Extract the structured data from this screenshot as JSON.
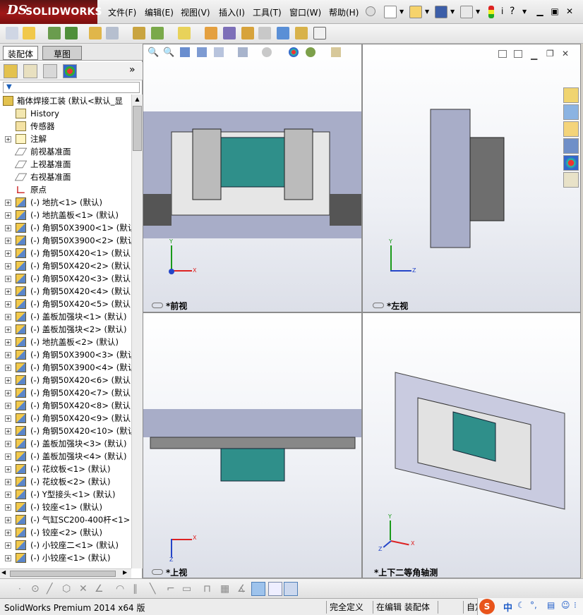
{
  "app": {
    "logo_ds": "DS",
    "logo_name": "SOLIDWORKS"
  },
  "menu": [
    "文件(F)",
    "编辑(E)",
    "视图(V)",
    "插入(I)",
    "工具(T)",
    "窗口(W)",
    "帮助(H)"
  ],
  "panel": {
    "tabs": [
      "装配体",
      "草图"
    ],
    "expand_glyph": "»",
    "filter_glyph": "▼"
  },
  "tree": {
    "root": "箱体焊接工装  (默认<默认_显",
    "items": [
      {
        "label": "History",
        "icon": "history-icon",
        "expand": false
      },
      {
        "label": "传感器",
        "icon": "sensor-icon",
        "expand": false
      },
      {
        "label": "注解",
        "icon": "annotation-icon",
        "expand": true
      },
      {
        "label": "前视基准面",
        "icon": "plane-icon",
        "expand": false
      },
      {
        "label": "上视基准面",
        "icon": "plane-icon",
        "expand": false
      },
      {
        "label": "右视基准面",
        "icon": "plane-icon",
        "expand": false
      },
      {
        "label": "原点",
        "icon": "origin-icon",
        "expand": false
      },
      {
        "label": "(-) 地抗<1> (默认)",
        "icon": "part-icon",
        "expand": true
      },
      {
        "label": "(-) 地抗盖板<1> (默认)",
        "icon": "part-icon",
        "expand": true
      },
      {
        "label": "(-) 角钢50X3900<1> (默认",
        "icon": "part-icon",
        "expand": true
      },
      {
        "label": "(-) 角钢50X3900<2> (默认",
        "icon": "part-icon",
        "expand": true
      },
      {
        "label": "(-) 角钢50X420<1> (默认)",
        "icon": "part-icon",
        "expand": true
      },
      {
        "label": "(-) 角钢50X420<2> (默认)",
        "icon": "part-icon",
        "expand": true
      },
      {
        "label": "(-) 角钢50X420<3> (默认)",
        "icon": "part-icon",
        "expand": true
      },
      {
        "label": "(-) 角钢50X420<4> (默认)",
        "icon": "part-icon",
        "expand": true
      },
      {
        "label": "(-) 角钢50X420<5> (默认)",
        "icon": "part-icon",
        "expand": true
      },
      {
        "label": "(-) 盖板加强块<1> (默认)",
        "icon": "part-icon",
        "expand": true
      },
      {
        "label": "(-) 盖板加强块<2> (默认)",
        "icon": "part-icon",
        "expand": true
      },
      {
        "label": "(-) 地抗盖板<2> (默认)",
        "icon": "part-icon",
        "expand": true
      },
      {
        "label": "(-) 角钢50X3900<3> (默认",
        "icon": "part-icon",
        "expand": true
      },
      {
        "label": "(-) 角钢50X3900<4> (默认",
        "icon": "part-icon",
        "expand": true
      },
      {
        "label": "(-) 角钢50X420<6> (默认)",
        "icon": "part-icon",
        "expand": true
      },
      {
        "label": "(-) 角钢50X420<7> (默认)",
        "icon": "part-icon",
        "expand": true
      },
      {
        "label": "(-) 角钢50X420<8> (默认)",
        "icon": "part-icon",
        "expand": true
      },
      {
        "label": "(-) 角钢50X420<9> (默认)",
        "icon": "part-icon",
        "expand": true
      },
      {
        "label": "(-) 角钢50X420<10> (默认",
        "icon": "part-icon",
        "expand": true
      },
      {
        "label": "(-) 盖板加强块<3> (默认)",
        "icon": "part-icon",
        "expand": true
      },
      {
        "label": "(-) 盖板加强块<4> (默认)",
        "icon": "part-icon",
        "expand": true
      },
      {
        "label": "(-) 花纹板<1> (默认)",
        "icon": "part-icon",
        "expand": true
      },
      {
        "label": "(-) 花纹板<2> (默认)",
        "icon": "part-icon",
        "expand": true
      },
      {
        "label": "(-) Y型接头<1> (默认)",
        "icon": "part-icon",
        "expand": true
      },
      {
        "label": "(-) 铰座<1> (默认)",
        "icon": "part-icon",
        "expand": true
      },
      {
        "label": "(-) 气缸SC200-400杆<1> (",
        "icon": "part-icon",
        "expand": true
      },
      {
        "label": "(-) 铰座<2> (默认)",
        "icon": "part-icon",
        "expand": true
      },
      {
        "label": "(-) 小铰座二<1> (默认)",
        "icon": "part-icon",
        "expand": true
      },
      {
        "label": "(-) 小铰座<1> (默认)",
        "icon": "part-icon",
        "expand": true
      }
    ]
  },
  "viewports": {
    "front": {
      "label": "*前视",
      "axes": [
        "Y",
        "X"
      ]
    },
    "left": {
      "label": "*左视",
      "axes": [
        "Y",
        "Z"
      ]
    },
    "top": {
      "label": "*上视",
      "axes": [
        "X",
        "Z"
      ]
    },
    "iso": {
      "label": "*上下二等角轴测",
      "axes": [
        "Y",
        "X",
        "Z"
      ]
    }
  },
  "status": {
    "product": "SolidWorks Premium 2014 x64 版",
    "state": "完全定义",
    "mode": "在编辑 装配体",
    "custom": "自定"
  },
  "ime": {
    "brand": "S",
    "lang": "中"
  }
}
